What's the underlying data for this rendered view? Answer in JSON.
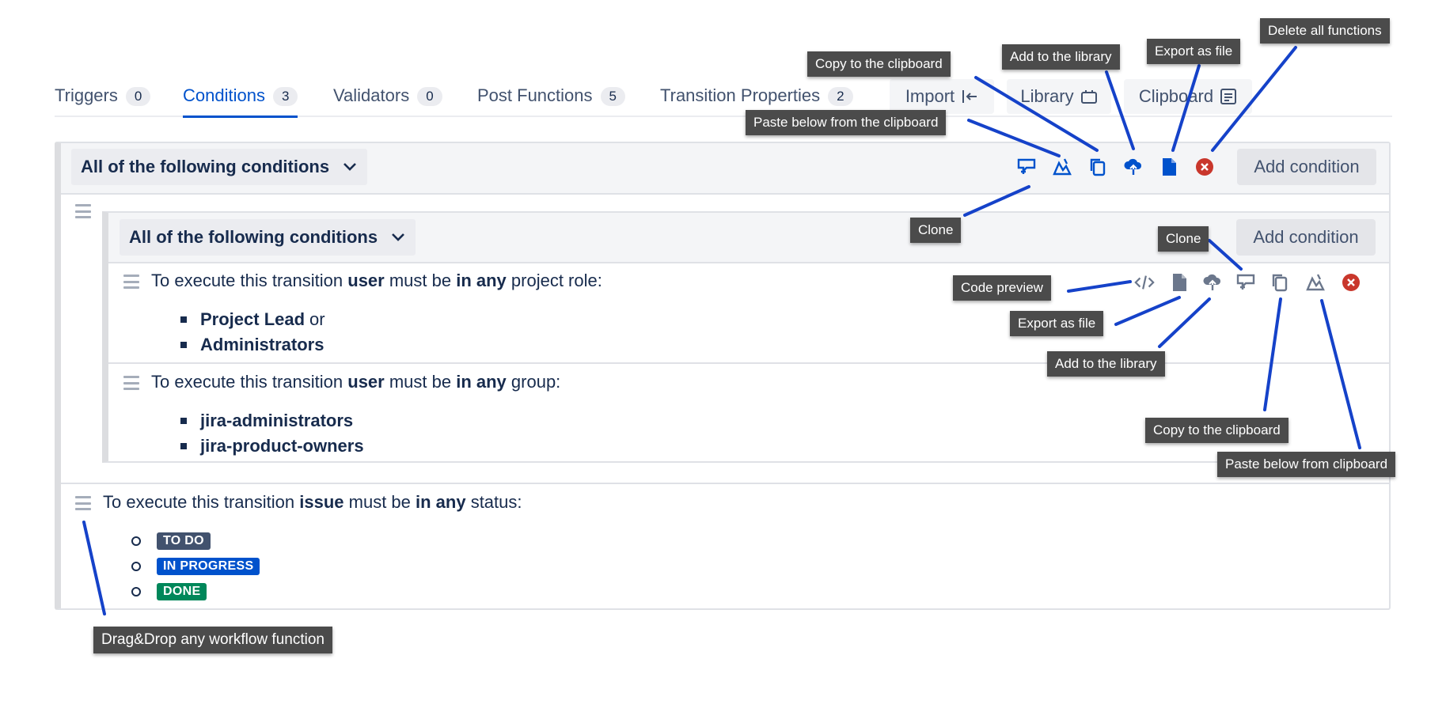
{
  "tabs": [
    {
      "label": "Triggers",
      "count": "0"
    },
    {
      "label": "Conditions",
      "count": "3"
    },
    {
      "label": "Validators",
      "count": "0"
    },
    {
      "label": "Post Functions",
      "count": "5"
    },
    {
      "label": "Transition Properties",
      "count": "2"
    }
  ],
  "toolbar": {
    "import": "Import",
    "library": "Library",
    "clipboard": "Clipboard"
  },
  "outer_group": {
    "title": "All of the following conditions",
    "add_button": "Add condition"
  },
  "inner_group": {
    "title": "All of the following conditions",
    "add_button": "Add condition"
  },
  "condition_role": {
    "p1": "To execute this transition ",
    "b1": "user",
    "p2": " must be ",
    "b2": "in any",
    "p3": " project role:",
    "items": [
      "Project Lead",
      "Administrators"
    ],
    "or": "or"
  },
  "condition_group": {
    "p1": "To execute this transition ",
    "b1": "user",
    "p2": " must be ",
    "b2": "in any",
    "p3": " group:",
    "items": [
      "jira-administrators",
      "jira-product-owners"
    ]
  },
  "condition_status": {
    "p1": "To execute this transition ",
    "b1": "issue",
    "p2": " must be ",
    "b2": "in any",
    "p3": " status:",
    "statuses": [
      {
        "label": "TO DO",
        "color": "#42526e"
      },
      {
        "label": "IN PROGRESS",
        "color": "#0052cc"
      },
      {
        "label": "DONE",
        "color": "#00875a"
      }
    ]
  },
  "tooltips": {
    "delete_all": "Delete all functions",
    "copy_top": "Copy to the clipboard",
    "add_library_top": "Add to the library",
    "export_top": "Export as file",
    "paste_top": "Paste below from the clipboard",
    "clone_top": "Clone",
    "clone_right": "Clone",
    "code_preview": "Code preview",
    "export_mid": "Export as file",
    "add_library_mid": "Add to the library",
    "copy_mid": "Copy to the clipboard",
    "paste_mid": "Paste below from clipboard",
    "drag_drop": "Drag&Drop any workflow function"
  },
  "colors": {
    "accent": "#0052cc",
    "danger": "#c9372c",
    "tooltip_bg": "#4b4b4b",
    "connector": "#1542c9"
  }
}
